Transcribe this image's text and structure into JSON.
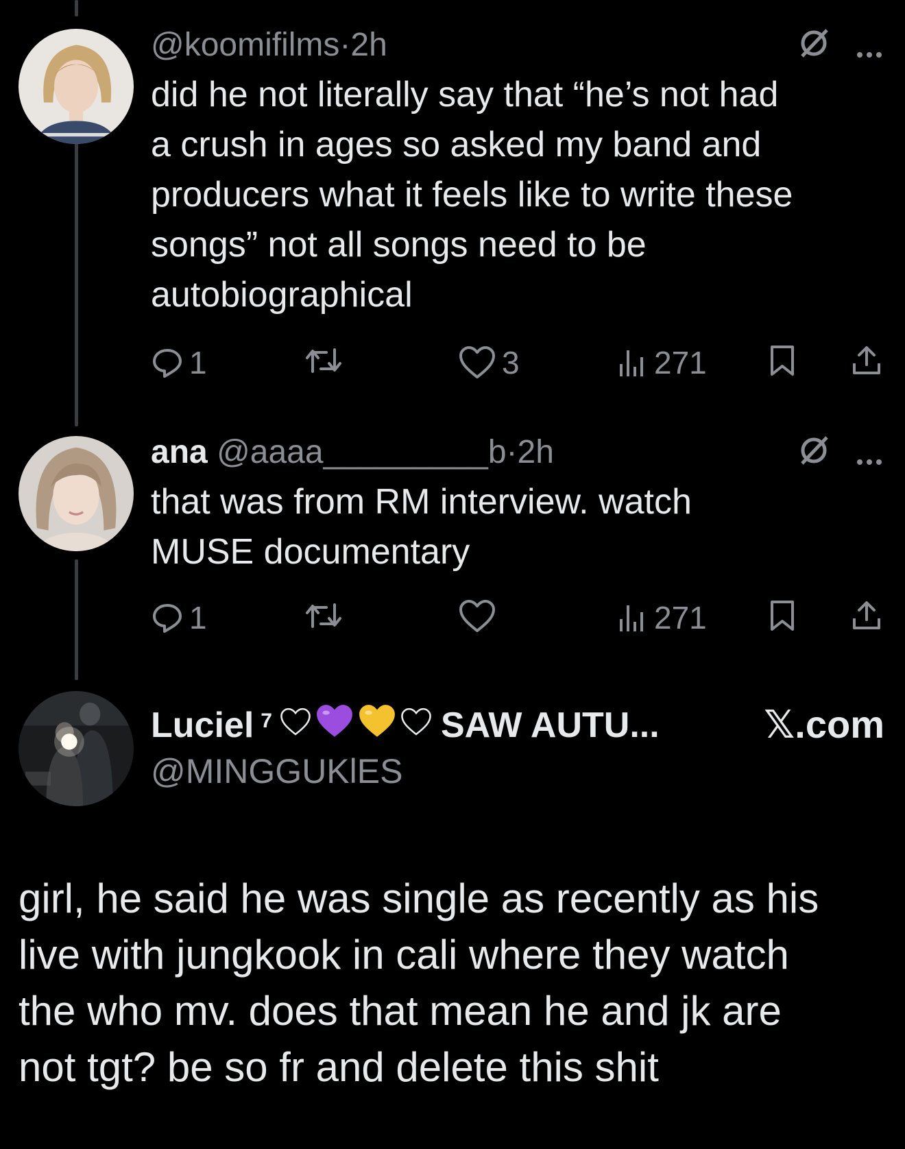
{
  "tweets": [
    {
      "name": "",
      "handle": "@koomifilms",
      "sep": "·",
      "time": "2h",
      "text": "did he not literally say that “he’s not had\na crush in ages so asked my band and\nproducers what it feels like to write these\nsongs” not all songs need to be\nautobiographical",
      "replies": "1",
      "retweets": "",
      "likes": "3",
      "views": "271"
    },
    {
      "name": "ana",
      "handle": "@aaaa_________b",
      "sep": "·",
      "time": "2h",
      "text": "that was from RM interview. watch\nMUSE documentary",
      "replies": "1",
      "retweets": "",
      "likes": "",
      "views": "271"
    }
  ],
  "quote": {
    "name_prefix": "Luciel",
    "superscript": "7",
    "name_suffix": "SAW AUTU...",
    "handle": "@MINGGUKlES",
    "brand": "𝕏.com",
    "text": "girl, he said he was single as recently as his\nlive with jungkook in cali where they watch\nthe who mv. does that mean he and jk are\nnot tgt? be so fr and delete this shit"
  },
  "colors": {
    "background": "#000000",
    "text": "#e7e9ea",
    "muted": "#8b8f94",
    "purple_heart": "#9b4de0",
    "yellow_heart": "#f5c22f"
  },
  "icons": [
    "reply-icon",
    "retweet-icon",
    "like-icon",
    "views-icon",
    "bookmark-icon",
    "share-icon",
    "grok-icon",
    "more-icon"
  ]
}
